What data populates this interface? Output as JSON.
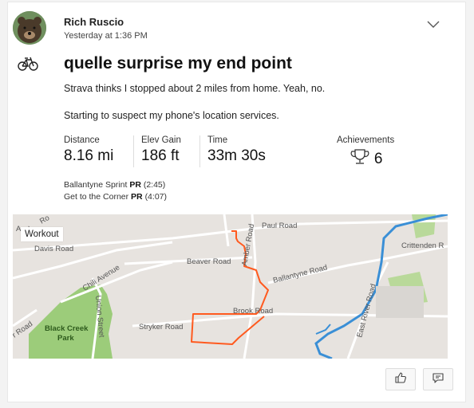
{
  "post": {
    "author": "Rich Ruscio",
    "timestamp": "Yesterday at 1:36 PM",
    "title": "quelle surprise my end point",
    "description_line1": "Strava thinks I stopped about 2 miles from home. Yeah, no.",
    "description_line2": "Starting to suspect my phone's location services."
  },
  "stats": {
    "distance": {
      "label": "Distance",
      "value": "8.16 mi"
    },
    "elev_gain": {
      "label": "Elev Gain",
      "value": "186 ft"
    },
    "time": {
      "label": "Time",
      "value": "33m 30s"
    },
    "achievements": {
      "label": "Achievements",
      "value": "6"
    }
  },
  "personal_records": [
    {
      "segment": "Ballantyne Sprint",
      "badge": "PR",
      "time": "(2:45)"
    },
    {
      "segment": "Get to the Corner",
      "badge": "PR",
      "time": "(4:07)"
    }
  ],
  "map": {
    "badge": "Workout",
    "labels": {
      "davis": "Davis Road",
      "paul": "Paul Road",
      "crittenden": "Crittenden R",
      "beaver": "Beaver Road",
      "amber": "Amber Road",
      "ballantyne": "Ballantyne Road",
      "chili": "Chili Avenue",
      "union": "Union Street",
      "brook": "Brook Road",
      "stryker": "Stryker Road",
      "east_river": "East River Road",
      "park_line1": "Black Creek",
      "park_line2": "Park",
      "edge_ad": "Ad",
      "edge_ro": "Ro",
      "edge_a": "A",
      "edge_road": "r Road"
    },
    "colors": {
      "route": "#ff5a1f",
      "river": "#3a8fd6",
      "park": "#9ccc7a",
      "land": "#e7e3df",
      "road": "#ffffff"
    }
  },
  "actions": {
    "like_icon": "thumbs-up-icon",
    "comment_icon": "comment-icon",
    "menu_icon": "chevron-down-icon",
    "sport_icon": "bicycle-icon"
  }
}
